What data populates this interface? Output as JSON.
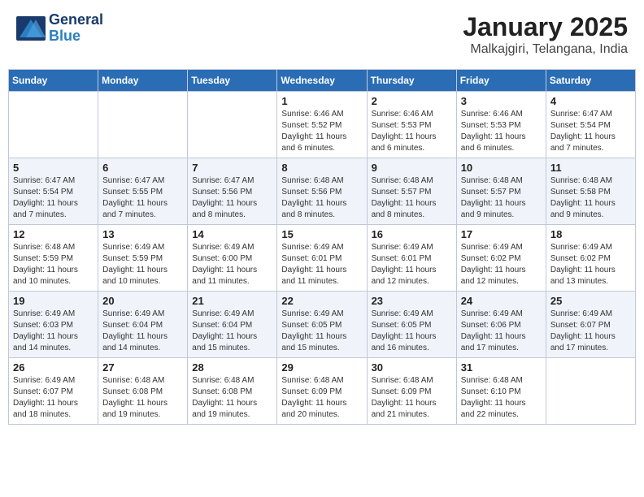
{
  "header": {
    "logo_line1": "General",
    "logo_line2": "Blue",
    "month": "January 2025",
    "location": "Malkajgiri, Telangana, India"
  },
  "weekdays": [
    "Sunday",
    "Monday",
    "Tuesday",
    "Wednesday",
    "Thursday",
    "Friday",
    "Saturday"
  ],
  "weeks": [
    [
      {
        "day": "",
        "sunrise": "",
        "sunset": "",
        "daylight": ""
      },
      {
        "day": "",
        "sunrise": "",
        "sunset": "",
        "daylight": ""
      },
      {
        "day": "",
        "sunrise": "",
        "sunset": "",
        "daylight": ""
      },
      {
        "day": "1",
        "sunrise": "Sunrise: 6:46 AM",
        "sunset": "Sunset: 5:52 PM",
        "daylight": "Daylight: 11 hours and 6 minutes."
      },
      {
        "day": "2",
        "sunrise": "Sunrise: 6:46 AM",
        "sunset": "Sunset: 5:53 PM",
        "daylight": "Daylight: 11 hours and 6 minutes."
      },
      {
        "day": "3",
        "sunrise": "Sunrise: 6:46 AM",
        "sunset": "Sunset: 5:53 PM",
        "daylight": "Daylight: 11 hours and 6 minutes."
      },
      {
        "day": "4",
        "sunrise": "Sunrise: 6:47 AM",
        "sunset": "Sunset: 5:54 PM",
        "daylight": "Daylight: 11 hours and 7 minutes."
      }
    ],
    [
      {
        "day": "5",
        "sunrise": "Sunrise: 6:47 AM",
        "sunset": "Sunset: 5:54 PM",
        "daylight": "Daylight: 11 hours and 7 minutes."
      },
      {
        "day": "6",
        "sunrise": "Sunrise: 6:47 AM",
        "sunset": "Sunset: 5:55 PM",
        "daylight": "Daylight: 11 hours and 7 minutes."
      },
      {
        "day": "7",
        "sunrise": "Sunrise: 6:47 AM",
        "sunset": "Sunset: 5:56 PM",
        "daylight": "Daylight: 11 hours and 8 minutes."
      },
      {
        "day": "8",
        "sunrise": "Sunrise: 6:48 AM",
        "sunset": "Sunset: 5:56 PM",
        "daylight": "Daylight: 11 hours and 8 minutes."
      },
      {
        "day": "9",
        "sunrise": "Sunrise: 6:48 AM",
        "sunset": "Sunset: 5:57 PM",
        "daylight": "Daylight: 11 hours and 8 minutes."
      },
      {
        "day": "10",
        "sunrise": "Sunrise: 6:48 AM",
        "sunset": "Sunset: 5:57 PM",
        "daylight": "Daylight: 11 hours and 9 minutes."
      },
      {
        "day": "11",
        "sunrise": "Sunrise: 6:48 AM",
        "sunset": "Sunset: 5:58 PM",
        "daylight": "Daylight: 11 hours and 9 minutes."
      }
    ],
    [
      {
        "day": "12",
        "sunrise": "Sunrise: 6:48 AM",
        "sunset": "Sunset: 5:59 PM",
        "daylight": "Daylight: 11 hours and 10 minutes."
      },
      {
        "day": "13",
        "sunrise": "Sunrise: 6:49 AM",
        "sunset": "Sunset: 5:59 PM",
        "daylight": "Daylight: 11 hours and 10 minutes."
      },
      {
        "day": "14",
        "sunrise": "Sunrise: 6:49 AM",
        "sunset": "Sunset: 6:00 PM",
        "daylight": "Daylight: 11 hours and 11 minutes."
      },
      {
        "day": "15",
        "sunrise": "Sunrise: 6:49 AM",
        "sunset": "Sunset: 6:01 PM",
        "daylight": "Daylight: 11 hours and 11 minutes."
      },
      {
        "day": "16",
        "sunrise": "Sunrise: 6:49 AM",
        "sunset": "Sunset: 6:01 PM",
        "daylight": "Daylight: 11 hours and 12 minutes."
      },
      {
        "day": "17",
        "sunrise": "Sunrise: 6:49 AM",
        "sunset": "Sunset: 6:02 PM",
        "daylight": "Daylight: 11 hours and 12 minutes."
      },
      {
        "day": "18",
        "sunrise": "Sunrise: 6:49 AM",
        "sunset": "Sunset: 6:02 PM",
        "daylight": "Daylight: 11 hours and 13 minutes."
      }
    ],
    [
      {
        "day": "19",
        "sunrise": "Sunrise: 6:49 AM",
        "sunset": "Sunset: 6:03 PM",
        "daylight": "Daylight: 11 hours and 14 minutes."
      },
      {
        "day": "20",
        "sunrise": "Sunrise: 6:49 AM",
        "sunset": "Sunset: 6:04 PM",
        "daylight": "Daylight: 11 hours and 14 minutes."
      },
      {
        "day": "21",
        "sunrise": "Sunrise: 6:49 AM",
        "sunset": "Sunset: 6:04 PM",
        "daylight": "Daylight: 11 hours and 15 minutes."
      },
      {
        "day": "22",
        "sunrise": "Sunrise: 6:49 AM",
        "sunset": "Sunset: 6:05 PM",
        "daylight": "Daylight: 11 hours and 15 minutes."
      },
      {
        "day": "23",
        "sunrise": "Sunrise: 6:49 AM",
        "sunset": "Sunset: 6:05 PM",
        "daylight": "Daylight: 11 hours and 16 minutes."
      },
      {
        "day": "24",
        "sunrise": "Sunrise: 6:49 AM",
        "sunset": "Sunset: 6:06 PM",
        "daylight": "Daylight: 11 hours and 17 minutes."
      },
      {
        "day": "25",
        "sunrise": "Sunrise: 6:49 AM",
        "sunset": "Sunset: 6:07 PM",
        "daylight": "Daylight: 11 hours and 17 minutes."
      }
    ],
    [
      {
        "day": "26",
        "sunrise": "Sunrise: 6:49 AM",
        "sunset": "Sunset: 6:07 PM",
        "daylight": "Daylight: 11 hours and 18 minutes."
      },
      {
        "day": "27",
        "sunrise": "Sunrise: 6:48 AM",
        "sunset": "Sunset: 6:08 PM",
        "daylight": "Daylight: 11 hours and 19 minutes."
      },
      {
        "day": "28",
        "sunrise": "Sunrise: 6:48 AM",
        "sunset": "Sunset: 6:08 PM",
        "daylight": "Daylight: 11 hours and 19 minutes."
      },
      {
        "day": "29",
        "sunrise": "Sunrise: 6:48 AM",
        "sunset": "Sunset: 6:09 PM",
        "daylight": "Daylight: 11 hours and 20 minutes."
      },
      {
        "day": "30",
        "sunrise": "Sunrise: 6:48 AM",
        "sunset": "Sunset: 6:09 PM",
        "daylight": "Daylight: 11 hours and 21 minutes."
      },
      {
        "day": "31",
        "sunrise": "Sunrise: 6:48 AM",
        "sunset": "Sunset: 6:10 PM",
        "daylight": "Daylight: 11 hours and 22 minutes."
      },
      {
        "day": "",
        "sunrise": "",
        "sunset": "",
        "daylight": ""
      }
    ]
  ]
}
